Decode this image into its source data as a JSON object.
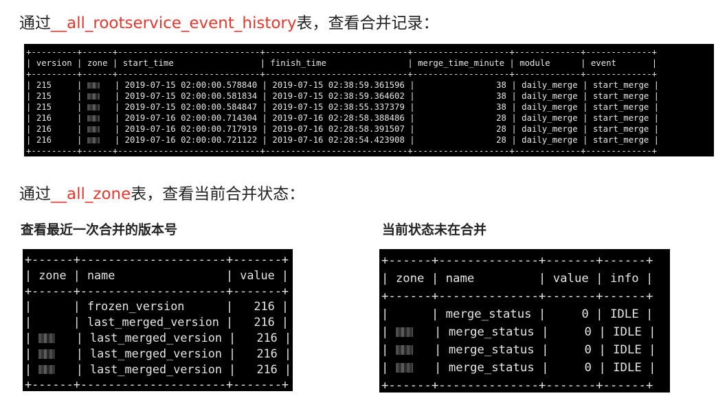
{
  "heading1": {
    "prefix": "通过",
    "table": "__all_rootservice_event_history",
    "suffix": "表，查看合并记录："
  },
  "heading2": {
    "prefix": "通过",
    "table": "__all_zone",
    "suffix": "表，查看当前合并状态："
  },
  "sub_left": "查看最近一次合并的版本号",
  "sub_right": "当前状态未在合并",
  "event_table": {
    "columns": [
      "version",
      "zone",
      "start_time",
      "finish_time",
      "merge_time_minute",
      "module",
      "event"
    ],
    "rows": [
      [
        "215",
        "",
        "2019-07-15 02:00:00.578840",
        "2019-07-15 02:38:59.361596",
        "38",
        "daily_merge",
        "start_merge"
      ],
      [
        "215",
        "",
        "2019-07-15 02:00:00.581834",
        "2019-07-15 02:38:59.364602",
        "38",
        "daily_merge",
        "start_merge"
      ],
      [
        "215",
        "",
        "2019-07-15 02:00:00.584847",
        "2019-07-15 02:38:55.337379",
        "38",
        "daily_merge",
        "start_merge"
      ],
      [
        "216",
        "",
        "2019-07-16 02:00:00.714304",
        "2019-07-16 02:28:58.388486",
        "28",
        "daily_merge",
        "start_merge"
      ],
      [
        "216",
        "",
        "2019-07-16 02:00:00.717919",
        "2019-07-16 02:28:58.391507",
        "28",
        "daily_merge",
        "start_merge"
      ],
      [
        "216",
        "",
        "2019-07-16 02:00:00.721122",
        "2019-07-16 02:28:54.423908",
        "28",
        "daily_merge",
        "start_merge"
      ]
    ]
  },
  "version_table": {
    "columns": [
      "zone",
      "name",
      "value"
    ],
    "rows": [
      [
        "",
        "frozen_version",
        "216"
      ],
      [
        "",
        "last_merged_version",
        "216"
      ],
      [
        "",
        "last_merged_version",
        "216"
      ],
      [
        "",
        "last_merged_version",
        "216"
      ],
      [
        "",
        "last_merged_version",
        "216"
      ]
    ]
  },
  "status_table": {
    "columns": [
      "zone",
      "name",
      "value",
      "info"
    ],
    "rows": [
      [
        "",
        "merge_status",
        "0",
        "IDLE"
      ],
      [
        "",
        "merge_status",
        "0",
        "IDLE"
      ],
      [
        "",
        "merge_status",
        "0",
        "IDLE"
      ],
      [
        "",
        "merge_status",
        "0",
        "IDLE"
      ]
    ]
  }
}
